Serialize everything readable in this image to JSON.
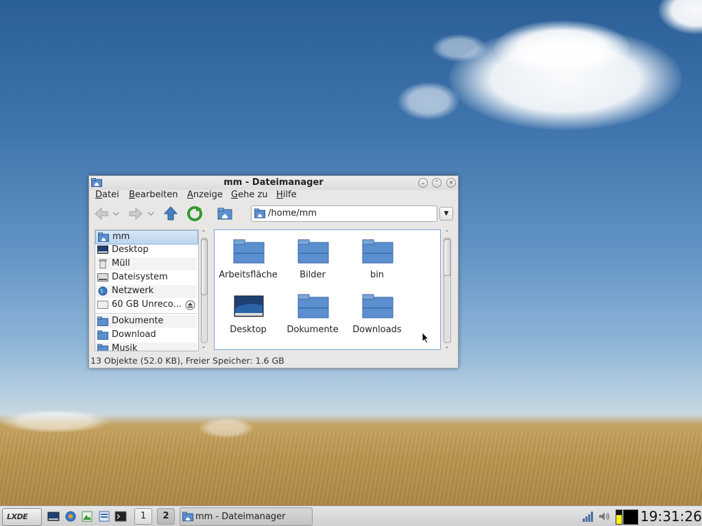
{
  "window": {
    "title": "mm - Dateimanager",
    "menu": [
      {
        "label": "Datei",
        "accel": "D"
      },
      {
        "label": "Bearbeiten",
        "accel": "B"
      },
      {
        "label": "Anzeige",
        "accel": "A"
      },
      {
        "label": "Gehe zu",
        "accel": "G"
      },
      {
        "label": "Hilfe",
        "accel": "H"
      }
    ],
    "address": "/home/mm",
    "places": [
      {
        "label": "mm",
        "icon": "home-folder-icon",
        "selected": true
      },
      {
        "label": "Desktop",
        "icon": "desktop-icon"
      },
      {
        "label": "Müll",
        "icon": "trash-icon"
      },
      {
        "label": "Dateisystem",
        "icon": "drive-icon"
      },
      {
        "label": "Netzwerk",
        "icon": "network-globe-icon"
      },
      {
        "label": "60 GB Unreco...",
        "icon": "drive-icon"
      },
      {
        "label": "Dokumente",
        "icon": "folder-icon"
      },
      {
        "label": "Download",
        "icon": "folder-icon"
      },
      {
        "label": "Musik",
        "icon": "folder-icon"
      }
    ],
    "files": [
      {
        "label": "Arbeitsfläche",
        "icon": "folder-icon"
      },
      {
        "label": "Bilder",
        "icon": "folder-icon"
      },
      {
        "label": "bin",
        "icon": "folder-icon"
      },
      {
        "label": "Desktop",
        "icon": "desktop-icon"
      },
      {
        "label": "Dokumente",
        "icon": "folder-icon"
      },
      {
        "label": "Downloads",
        "icon": "folder-icon"
      }
    ],
    "status": "13 Objekte (52.0 KB), Freier Speicher: 1.6 GB"
  },
  "taskbar": {
    "start_label": "LXDE",
    "workspaces": [
      "1",
      "2"
    ],
    "active_workspace": "2",
    "task_label": "mm - Dateimanager",
    "clock": "19:31:26"
  },
  "colors": {
    "selection": "#bcd5ee",
    "folder": "#5b8fcf",
    "iconview_border": "#7aa7d8"
  }
}
